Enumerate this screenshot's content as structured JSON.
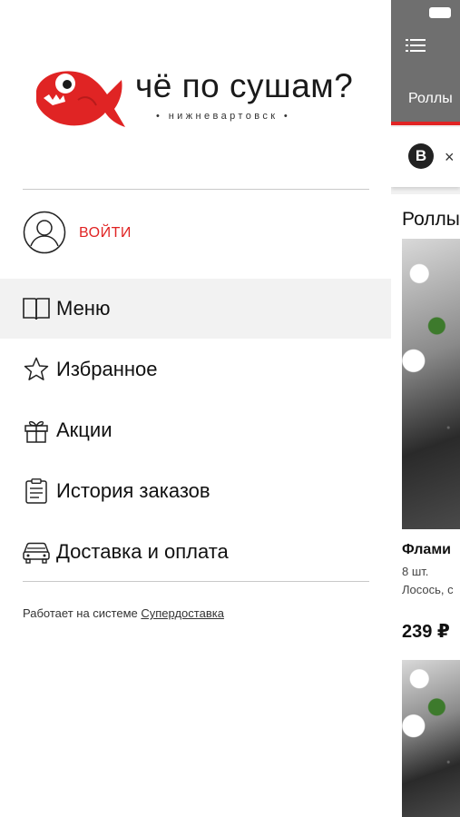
{
  "brand": {
    "name": "чё по сушам?",
    "city": "• нижневартовск •",
    "accent": "#e02424"
  },
  "drawer": {
    "login_label": "ВОЙТИ",
    "items": [
      {
        "label": "Меню",
        "icon": "book-icon",
        "active": true
      },
      {
        "label": "Избранное",
        "icon": "star-icon",
        "active": false
      },
      {
        "label": "Акции",
        "icon": "gift-icon",
        "active": false
      },
      {
        "label": "История заказов",
        "icon": "clipboard-icon",
        "active": false
      },
      {
        "label": "Доставка и оплата",
        "icon": "car-icon",
        "active": false
      }
    ],
    "footer_text": "Работает на системе ",
    "footer_link": "Супердоставка"
  },
  "app": {
    "tab_label": "Роллы",
    "filter_badge": "B",
    "filter_close": "×",
    "section_title": "Роллы",
    "product": {
      "name": "Флами",
      "qty": "8 шт.",
      "desc": "Лосось, с",
      "price": "239 ₽"
    }
  }
}
